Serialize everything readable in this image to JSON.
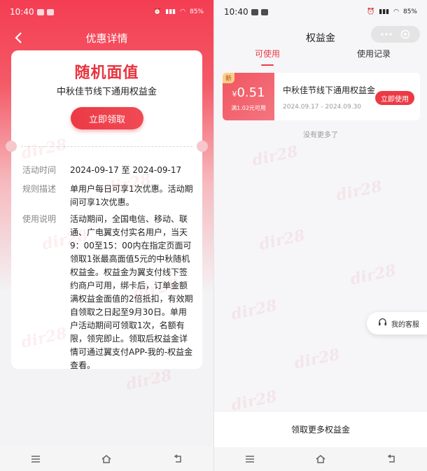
{
  "left": {
    "status_time": "10:40",
    "battery": "85%",
    "nav_title": "优惠详情",
    "card": {
      "title": "随机面值",
      "subtitle": "中秋佳节线下通用权益金",
      "claim_label": "立即领取",
      "rows": [
        {
          "key": "活动时间",
          "value": "2024-09-17 至 2024-09-17"
        },
        {
          "key": "规则描述",
          "value": "单用户每日可享1次优惠。活动期间可享1次优惠。"
        },
        {
          "key": "使用说明",
          "value": "活动期间，全国电信、移动、联通、广电翼支付实名用户，当天9：00至15：00内在指定页面可领取1张最高面值5元的中秋随机权益金。权益金为翼支付线下签约商户可用，绑卡后，订单金额满权益金面值的2倍抵扣，有效期自领取之日起至9月30日。单用户活动期间可领取1次，名额有限，领完即止。领取后权益金详情可通过翼支付APP-我的-权益金查看。"
        }
      ]
    }
  },
  "right": {
    "status_time": "10:40",
    "battery": "85%",
    "nav_title": "权益金",
    "tabs": [
      "可使用",
      "使用记录"
    ],
    "coupon": {
      "badge": "新",
      "currency": "¥",
      "amount": "0.51",
      "condition": "满1.02元可用",
      "name": "中秋佳节线下通用权益金",
      "date": "2024.09.17 - 2024.09.30",
      "use_label": "立即使用"
    },
    "no_more": "没有更多了",
    "service_label": "我的客服",
    "more_label": "领取更多权益金"
  },
  "watermark_text": "dir28",
  "colors": {
    "accent": "#ec3a45",
    "header_red": "#f43d52"
  }
}
